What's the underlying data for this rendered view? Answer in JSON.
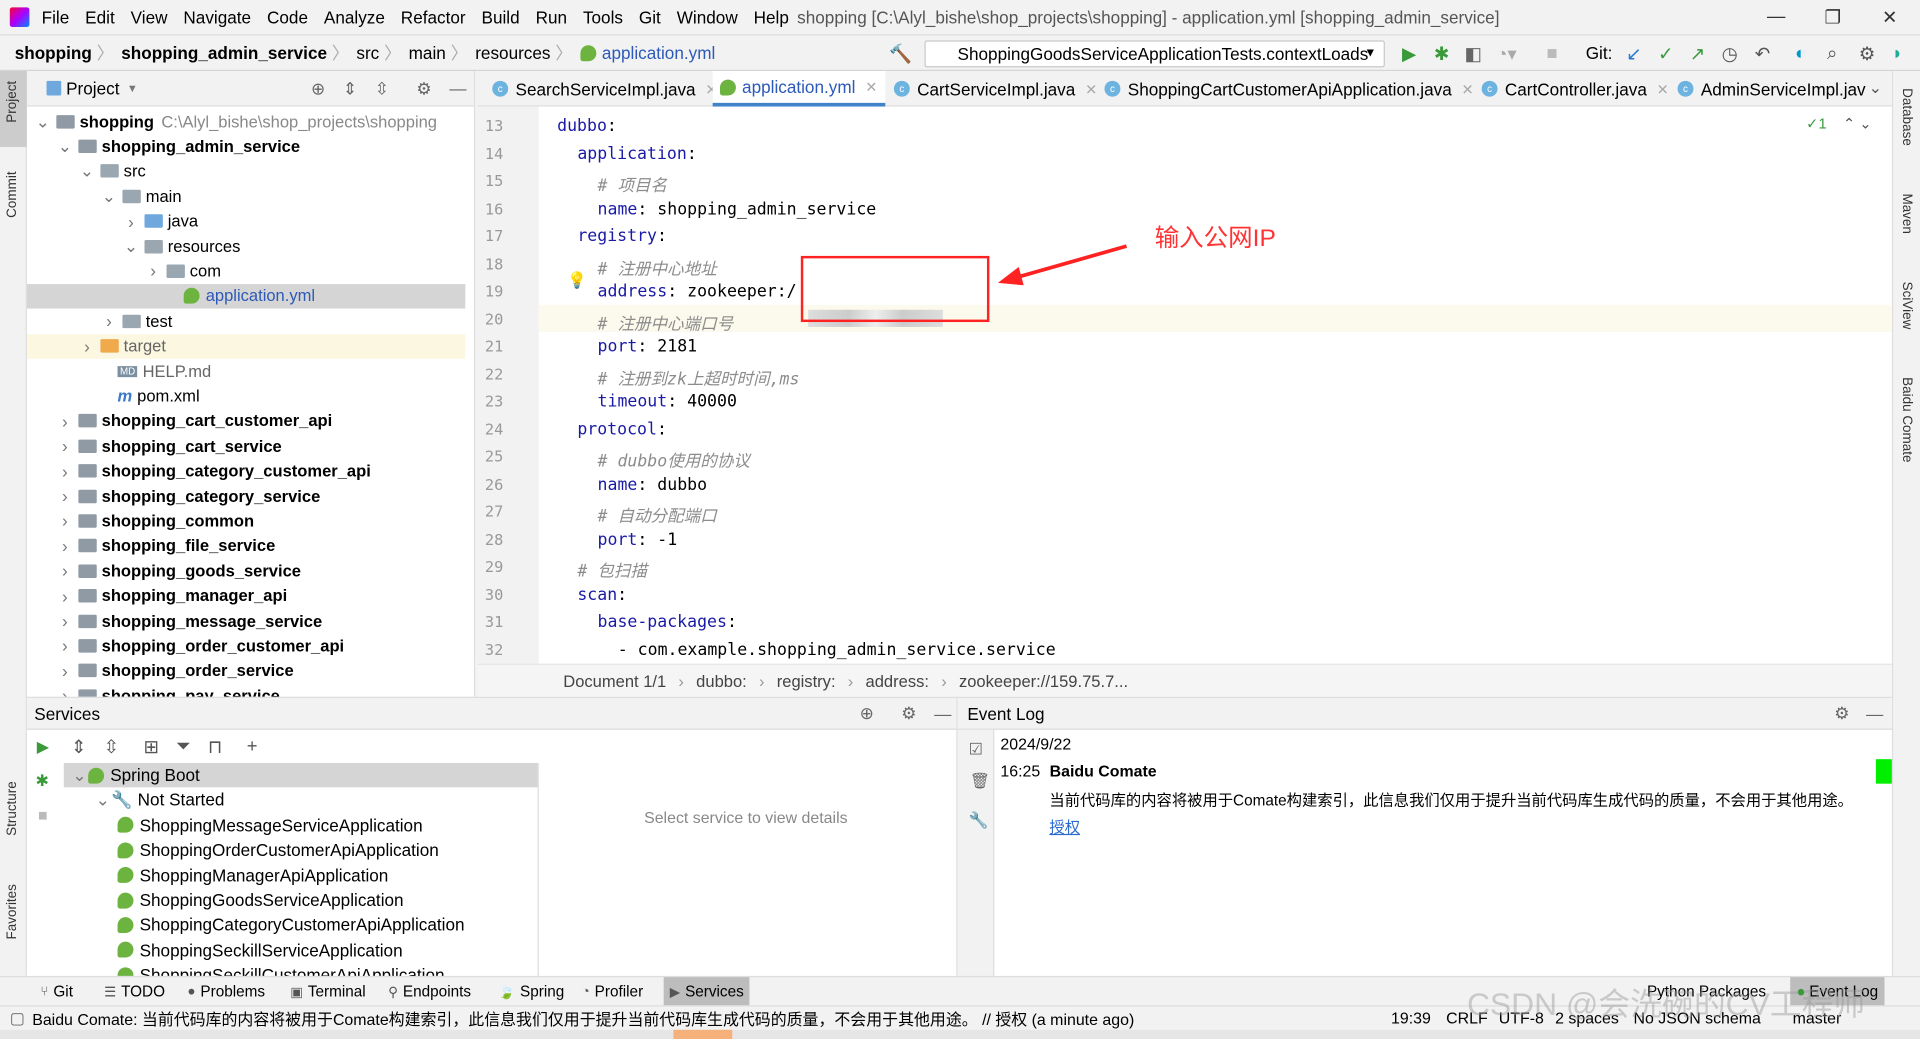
{
  "window": {
    "title": "shopping [C:\\Alyl_bishe\\shop_projects\\shopping] - application.yml [shopping_admin_service]"
  },
  "menu": [
    "File",
    "Edit",
    "View",
    "Navigate",
    "Code",
    "Analyze",
    "Refactor",
    "Build",
    "Run",
    "Tools",
    "Git",
    "Window",
    "Help"
  ],
  "breadcrumb": [
    "shopping",
    "shopping_admin_service",
    "src",
    "main",
    "resources",
    "application.yml"
  ],
  "toolbar": {
    "run_config": "ShoppingGoodsServiceApplicationTests.contextLoads",
    "git_label": "Git:"
  },
  "left_strip": [
    "Project",
    "Commit",
    "Structure",
    "Favorites"
  ],
  "right_strip": [
    "Database",
    "Maven",
    "SciView",
    "Baidu Comate"
  ],
  "project": {
    "title": "Project",
    "tree": [
      {
        "label": "shopping",
        "hint": "C:\\Alyl_bishe\\shop_projects\\shopping",
        "depth": 0,
        "bold": true,
        "open": true,
        "kind": "mod"
      },
      {
        "label": "shopping_admin_service",
        "depth": 1,
        "bold": true,
        "open": true,
        "kind": "mod"
      },
      {
        "label": "src",
        "depth": 2,
        "open": true,
        "kind": "folder"
      },
      {
        "label": "main",
        "depth": 3,
        "open": true,
        "kind": "folder"
      },
      {
        "label": "java",
        "depth": 4,
        "open": false,
        "kind": "blue"
      },
      {
        "label": "resources",
        "depth": 4,
        "open": true,
        "kind": "folder"
      },
      {
        "label": "com",
        "depth": 5,
        "open": false,
        "kind": "folder"
      },
      {
        "label": "application.yml",
        "depth": 6,
        "kind": "spring",
        "selected": true
      },
      {
        "label": "test",
        "depth": 3,
        "open": false,
        "kind": "folder"
      },
      {
        "label": "target",
        "depth": 2,
        "open": false,
        "kind": "orange",
        "highlight": true
      },
      {
        "label": "HELP.md",
        "depth": 3,
        "kind": "md"
      },
      {
        "label": "pom.xml",
        "depth": 3,
        "kind": "maven"
      },
      {
        "label": "shopping_cart_customer_api",
        "depth": 1,
        "bold": true,
        "open": false,
        "kind": "mod"
      },
      {
        "label": "shopping_cart_service",
        "depth": 1,
        "bold": true,
        "open": false,
        "kind": "mod"
      },
      {
        "label": "shopping_category_customer_api",
        "depth": 1,
        "bold": true,
        "open": false,
        "kind": "mod"
      },
      {
        "label": "shopping_category_service",
        "depth": 1,
        "bold": true,
        "open": false,
        "kind": "mod"
      },
      {
        "label": "shopping_common",
        "depth": 1,
        "bold": true,
        "open": false,
        "kind": "mod"
      },
      {
        "label": "shopping_file_service",
        "depth": 1,
        "bold": true,
        "open": false,
        "kind": "mod"
      },
      {
        "label": "shopping_goods_service",
        "depth": 1,
        "bold": true,
        "open": false,
        "kind": "mod"
      },
      {
        "label": "shopping_manager_api",
        "depth": 1,
        "bold": true,
        "open": false,
        "kind": "mod"
      },
      {
        "label": "shopping_message_service",
        "depth": 1,
        "bold": true,
        "open": false,
        "kind": "mod"
      },
      {
        "label": "shopping_order_customer_api",
        "depth": 1,
        "bold": true,
        "open": false,
        "kind": "mod"
      },
      {
        "label": "shopping_order_service",
        "depth": 1,
        "bold": true,
        "open": false,
        "kind": "mod"
      },
      {
        "label": "shopping_pay_service",
        "depth": 1,
        "bold": true,
        "open": false,
        "kind": "mod"
      }
    ]
  },
  "tabs": [
    {
      "label": "SearchServiceImpl.java",
      "icon": "class"
    },
    {
      "label": "application.yml",
      "icon": "spring",
      "active": true
    },
    {
      "label": "CartServiceImpl.java",
      "icon": "class"
    },
    {
      "label": "ShoppingCartCustomerApiApplication.java",
      "icon": "spring-class"
    },
    {
      "label": "CartController.java",
      "icon": "class"
    },
    {
      "label": "AdminServiceImpl.jav",
      "icon": "class"
    }
  ],
  "editor": {
    "inspection_count": "1",
    "lines": [
      {
        "n": "13",
        "indent": 0,
        "key": "dubbo",
        "sep": ":",
        "val": ""
      },
      {
        "n": "14",
        "indent": 1,
        "key": "application",
        "sep": ":",
        "val": ""
      },
      {
        "n": "15",
        "indent": 2,
        "comment": "# 项目名"
      },
      {
        "n": "16",
        "indent": 2,
        "key": "name",
        "sep": ": ",
        "val": "shopping_admin_service"
      },
      {
        "n": "17",
        "indent": 1,
        "key": "registry",
        "sep": ":",
        "val": ""
      },
      {
        "n": "18",
        "indent": 2,
        "comment": "# 注册中心地址"
      },
      {
        "n": "19",
        "indent": 2,
        "key": "address",
        "sep": ": ",
        "val": "zookeeper:/"
      },
      {
        "n": "20",
        "indent": 2,
        "comment": "# 注册中心端口号"
      },
      {
        "n": "21",
        "indent": 2,
        "key": "port",
        "sep": ": ",
        "val": "2181"
      },
      {
        "n": "22",
        "indent": 2,
        "comment": "# 注册到zk上超时时间,ms"
      },
      {
        "n": "23",
        "indent": 2,
        "key": "timeout",
        "sep": ": ",
        "val": "40000"
      },
      {
        "n": "24",
        "indent": 1,
        "key": "protocol",
        "sep": ":",
        "val": ""
      },
      {
        "n": "25",
        "indent": 2,
        "comment": "# dubbo使用的协议"
      },
      {
        "n": "26",
        "indent": 2,
        "key": "name",
        "sep": ": ",
        "val": "dubbo"
      },
      {
        "n": "27",
        "indent": 2,
        "comment": "# 自动分配端口"
      },
      {
        "n": "28",
        "indent": 2,
        "key": "port",
        "sep": ": ",
        "val": "-1"
      },
      {
        "n": "29",
        "indent": 1,
        "comment": "# 包扫描"
      },
      {
        "n": "30",
        "indent": 1,
        "key": "scan",
        "sep": ":",
        "val": ""
      },
      {
        "n": "31",
        "indent": 2,
        "key": "base-packages",
        "sep": ":",
        "val": ""
      },
      {
        "n": "32",
        "indent": 3,
        "key": "",
        "sep": "- ",
        "val": "com.example.shopping_admin_service.service"
      }
    ],
    "annotation": "输入公网IP",
    "crumbs": [
      "Document 1/1",
      "dubbo:",
      "registry:",
      "address:",
      "zookeeper://159.75.7..."
    ]
  },
  "services": {
    "title": "Services",
    "empty_text": "Select service to view details",
    "tree": [
      {
        "label": "Spring Boot",
        "depth": 0,
        "selected": true
      },
      {
        "label": "Not Started",
        "depth": 1
      },
      {
        "label": "ShoppingMessageServiceApplication",
        "depth": 2
      },
      {
        "label": "ShoppingOrderCustomerApiApplication",
        "depth": 2
      },
      {
        "label": "ShoppingManagerApiApplication",
        "depth": 2
      },
      {
        "label": "ShoppingGoodsServiceApplication",
        "depth": 2
      },
      {
        "label": "ShoppingCategoryCustomerApiApplication",
        "depth": 2
      },
      {
        "label": "ShoppingSeckillServiceApplication",
        "depth": 2
      },
      {
        "label": "ShoppingSeckillCustomerApiApplication",
        "depth": 2
      }
    ]
  },
  "event_log": {
    "title": "Event Log",
    "date": "2024/9/22",
    "time": "16:25",
    "source": "Baidu Comate",
    "message": "当前代码库的内容将被用于Comate构建索引，此信息我们仅用于提升当前代码库生成代码的质量，不会用于其他用途。",
    "link": "授权"
  },
  "tool_windows": [
    "Git",
    "TODO",
    "Problems",
    "Terminal",
    "Endpoints",
    "Spring",
    "Profiler",
    "Services"
  ],
  "tool_windows_right": [
    "Python Packages",
    "Event Log"
  ],
  "status": {
    "message": "Baidu Comate: 当前代码库的内容将被用于Comate构建索引，此信息我们仅用于提升当前代码库生成代码的质量，不会用于其他用途。 // 授权 (a minute ago)",
    "position": "19:39",
    "line_sep": "CRLF",
    "encoding": "UTF-8",
    "indent": "2 spaces",
    "schema": "No JSON schema",
    "branch": "master"
  },
  "watermark": "CSDN @会洗碗的CV工程师",
  "colors": {
    "accent": "#4083c9",
    "annotation": "#ff2222",
    "keyword": "#1a1aa6",
    "comment": "#8c8c8c"
  }
}
